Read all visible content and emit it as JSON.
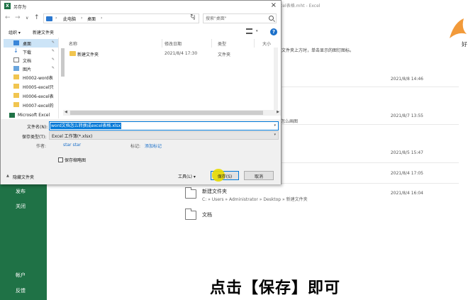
{
  "background": {
    "title": "excel表格.mht - Excel",
    "hint": "文件夹上方时，单击显示的图钉图标。",
    "avatar_text": "好",
    "left_menu": {
      "publish": "发布",
      "close": "关闭",
      "account": "帐户",
      "feedback": "反馈"
    },
    "rows": [
      {
        "date": "2021/8/8 14:46"
      },
      {
        "date": "2021/8/7 13:55"
      },
      {
        "date": "2021/8/5 15:47"
      },
      {
        "date": "2021/8/4 17:05"
      }
    ],
    "partial_text": "怎么画图",
    "folders": [
      {
        "name": "新建文件夹",
        "path": "C: » Users » Administrator » Desktop » 新建文件夹",
        "date": "2021/8/4 16:04"
      },
      {
        "name": "文档"
      }
    ],
    "colors": {
      "excel_green": "#1f7246",
      "accent_blue": "#0078d7",
      "highlight_yellow": "#e8dc00"
    }
  },
  "caption": "点击【保存】即可",
  "dialog": {
    "title": "另存为",
    "close_icon": "close-icon",
    "address": {
      "this_pc": "此电脑",
      "desktop": "桌面"
    },
    "search_placeholder": "搜索\"桌面\"",
    "toolbar": {
      "organize": "组织 ▾",
      "new_folder": "新建文件夹",
      "help": "?"
    },
    "nav": [
      {
        "label": "桌面",
        "icon": "desktop-icon",
        "pinned": true,
        "selected": true
      },
      {
        "label": "下载",
        "icon": "download-icon",
        "pinned": true
      },
      {
        "label": "文档",
        "icon": "document-icon",
        "pinned": true
      },
      {
        "label": "图片",
        "icon": "picture-icon",
        "pinned": true
      },
      {
        "label": "H0002-word表",
        "icon": "folder-icon"
      },
      {
        "label": "H0005-excel只",
        "icon": "folder-icon"
      },
      {
        "label": "H0006-excel表",
        "icon": "folder-icon"
      },
      {
        "label": "H0007-excel的",
        "icon": "folder-icon"
      },
      {
        "label": "Microsoft Excel",
        "icon": "excel-icon"
      }
    ],
    "columns": {
      "name": "名称",
      "modified": "修改日期",
      "type": "类型",
      "size": "大小"
    },
    "files": [
      {
        "name": "新建文件夹",
        "modified": "2021/8/4 17:30",
        "type": "文件夹"
      }
    ],
    "form": {
      "filename_label": "文件名(N):",
      "filename_value": "word文档怎么转换成excel表格.xlsx",
      "type_label": "保存类型(T):",
      "type_value": "Excel 工作簿(*.xlsx)",
      "author_label": "作者:",
      "author_value": "star star",
      "tags_label": "标记:",
      "tags_value": "添加标记",
      "thumbnail_label": "保存缩略图",
      "thumbnail_checked": false
    },
    "hide_folders": "隐藏文件夹",
    "tools": "工具(L) ▾",
    "save": "保存(S)",
    "cancel": "取消"
  }
}
